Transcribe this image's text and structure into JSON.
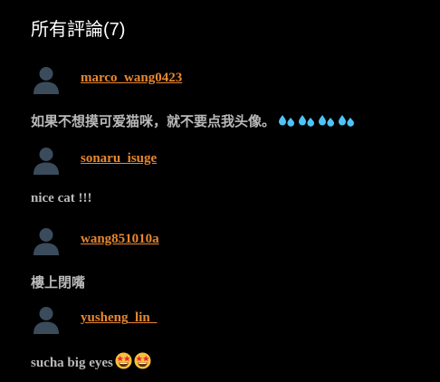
{
  "section": {
    "title": "所有評論(7)"
  },
  "comments": [
    {
      "username": "marco_wang0423",
      "text": "如果不想摸可爱猫咪，就不要点我头像。",
      "trailing_icons": [
        "sweat-droplets-icon",
        "sweat-droplets-icon",
        "sweat-droplets-icon",
        "sweat-droplets-icon"
      ]
    },
    {
      "username": "sonaru_isuge",
      "text": "nice cat !!!"
    },
    {
      "username": "wang851010a",
      "text": "樓上閉嘴"
    },
    {
      "username": "yusheng_lin_",
      "text": "sucha big eyes",
      "trailing_icons": [
        "star-struck-emoji-icon",
        "star-struck-emoji-icon"
      ]
    }
  ],
  "colors": {
    "background": "#000000",
    "title": "#ffffff",
    "username": "#e8872e",
    "comment_text": "#b9b9b9",
    "avatar": "#3a4b5c",
    "droplets": "#4fc3f7"
  }
}
